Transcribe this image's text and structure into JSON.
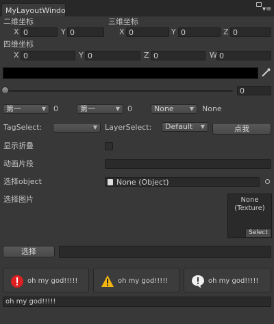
{
  "window": {
    "tab_title": "MyLayoutWindo",
    "menu_icon": "menu-icon",
    "lock_icon": "lock-icon"
  },
  "vector2": {
    "label": "二维坐标",
    "x_label": "X",
    "x": "0",
    "y_label": "Y",
    "y": "0"
  },
  "vector3": {
    "label": "三维坐标",
    "x_label": "X",
    "x": "0",
    "y_label": "Y",
    "y": "0",
    "z_label": "Z",
    "z": "0"
  },
  "vector4": {
    "label": "四维坐标",
    "x_label": "X",
    "x": "0",
    "y_label": "Y",
    "y": "0",
    "z_label": "Z",
    "z": "0",
    "w_label": "W",
    "w": "0"
  },
  "color_field": {
    "value": "#000000",
    "picker_icon": "eyedropper-icon"
  },
  "slider": {
    "value": "0",
    "fraction": 0.0
  },
  "popups": [
    {
      "selected": "第一",
      "value": "0"
    },
    {
      "selected": "第一",
      "value": "0"
    },
    {
      "selected": "None",
      "value": "None"
    }
  ],
  "tags": {
    "tag_label": "TagSelect:",
    "tag_value": "",
    "layer_label": "LayerSelect:",
    "layer_value": "Default",
    "button_label": "点我"
  },
  "toggle": {
    "label": "显示折叠",
    "checked": false
  },
  "anim": {
    "label": "动画片段",
    "value": ""
  },
  "object_field": {
    "label": "选择object",
    "value": "None (Object)",
    "file_icon": "document-icon",
    "picker_icon": "target-icon"
  },
  "texture_field": {
    "label": "选择图片",
    "value_line1": "None",
    "value_line2": "(Texture)",
    "select_label": "Select"
  },
  "select_row": {
    "button_label": "选择",
    "value": ""
  },
  "help_boxes": [
    {
      "icon": "error-icon",
      "text": "oh my god!!!!!"
    },
    {
      "icon": "warning-icon",
      "text": "oh my god!!!!!"
    },
    {
      "icon": "info-icon",
      "text": "oh my god!!!!!"
    }
  ],
  "bottom_text": "oh my god!!!!!"
}
